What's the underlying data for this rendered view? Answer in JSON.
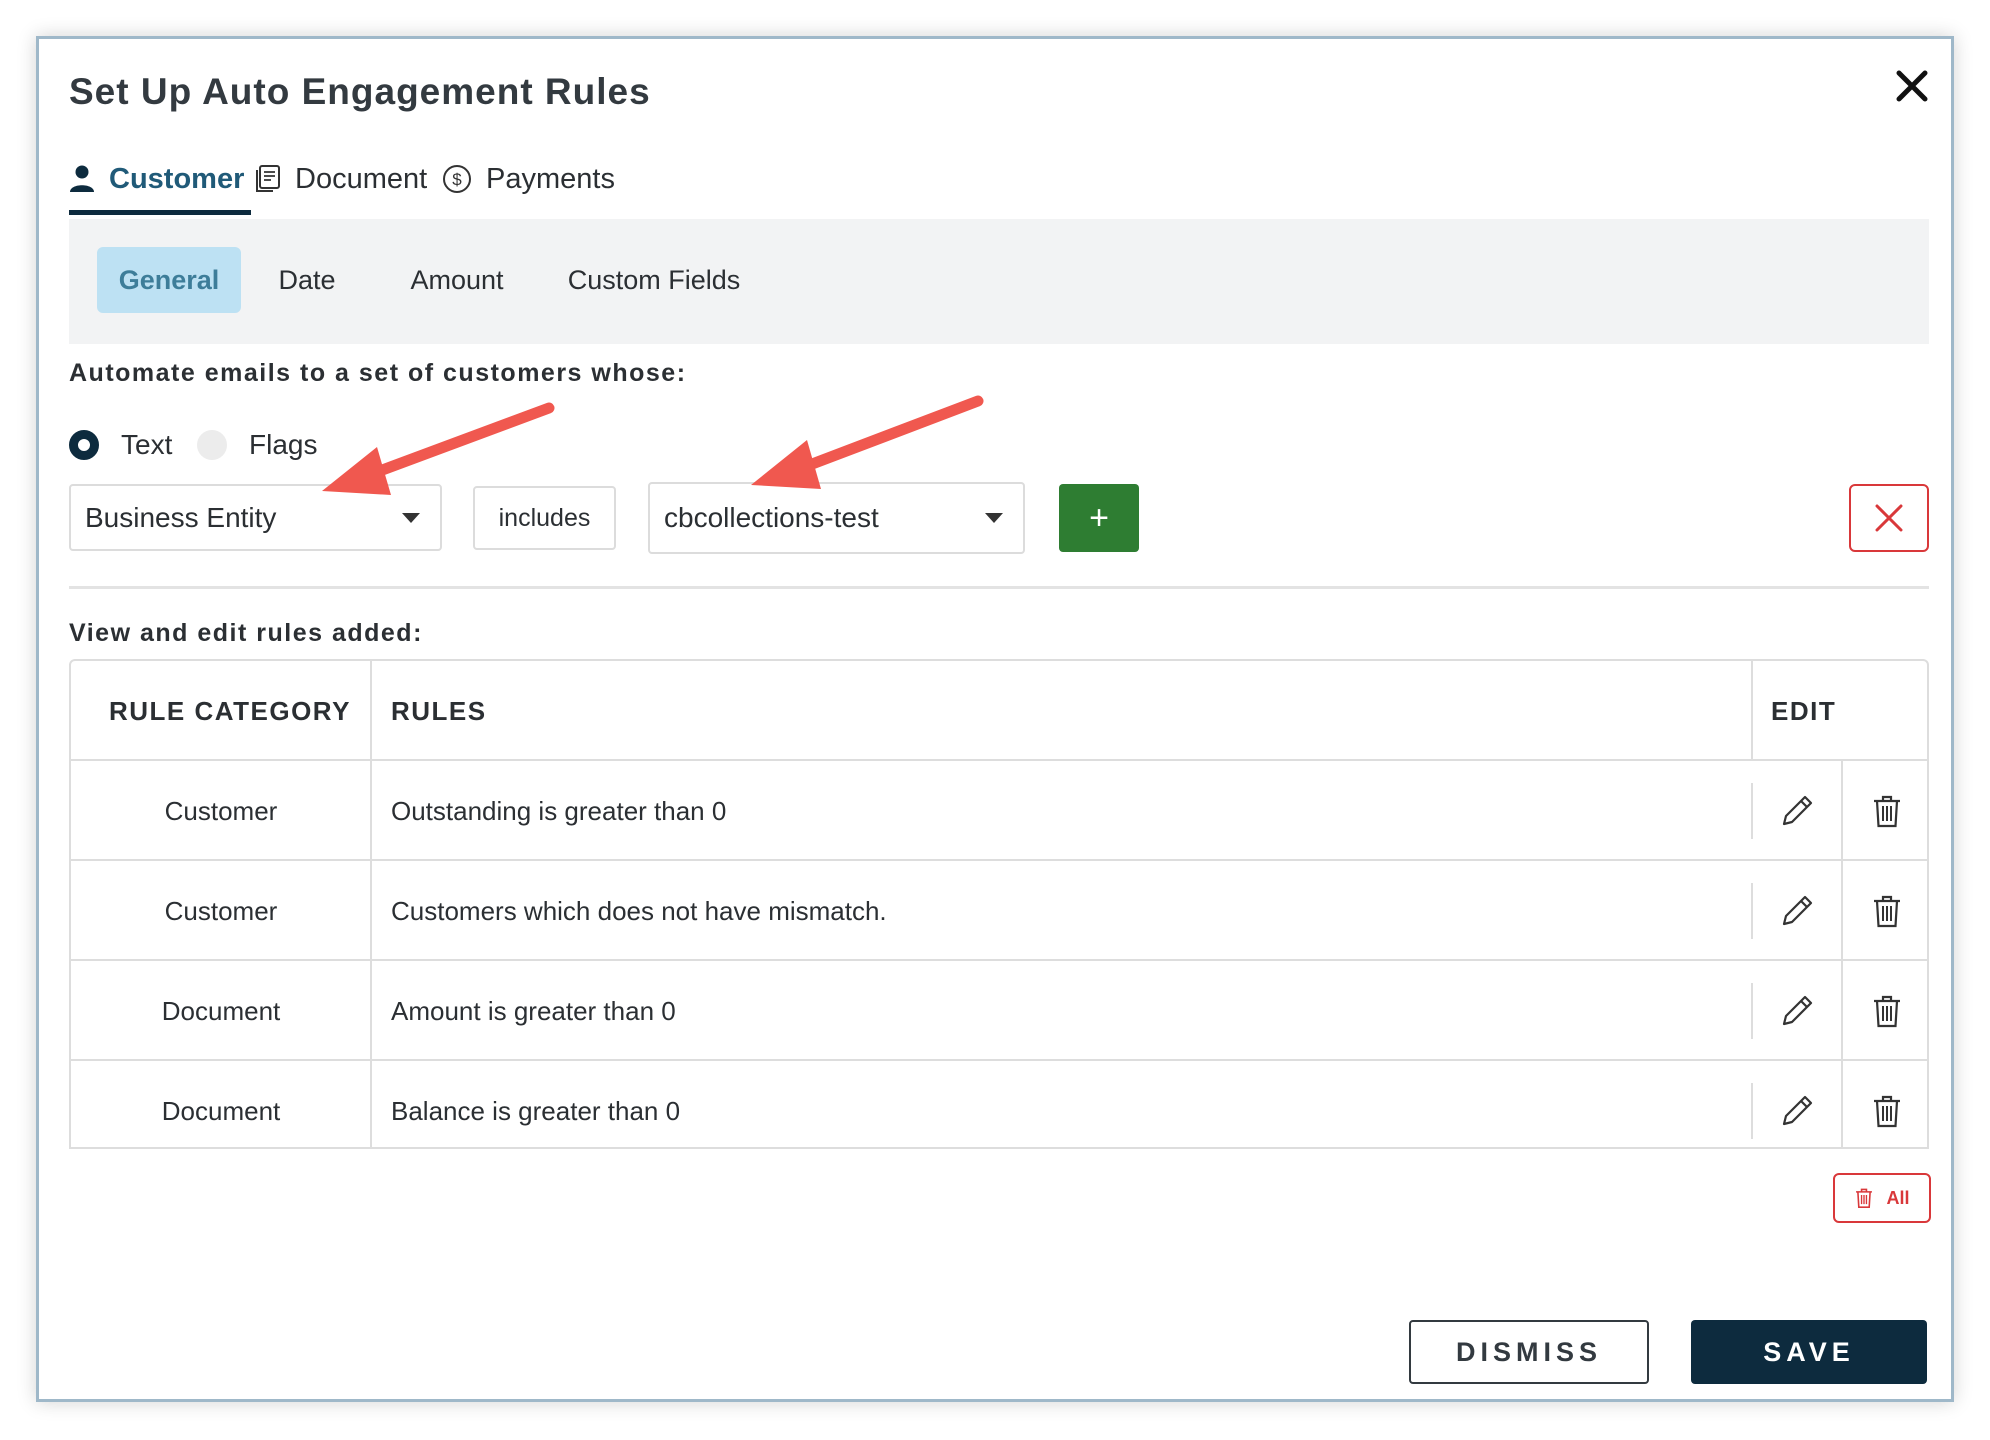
{
  "dialog": {
    "title": "Set Up Auto Engagement Rules"
  },
  "tabs": [
    {
      "label": "Customer",
      "icon": "person-icon",
      "active": true
    },
    {
      "label": "Document",
      "icon": "document-icon",
      "active": false
    },
    {
      "label": "Payments",
      "icon": "dollar-circle-icon",
      "active": false
    }
  ],
  "subtabs": [
    {
      "label": "General",
      "active": true
    },
    {
      "label": "Date",
      "active": false
    },
    {
      "label": "Amount",
      "active": false
    },
    {
      "label": "Custom Fields",
      "active": false
    }
  ],
  "automate": {
    "label": "Automate emails to a set of customers whose:",
    "radios": [
      {
        "label": "Text",
        "selected": true
      },
      {
        "label": "Flags",
        "selected": false
      }
    ]
  },
  "rule_builder": {
    "field_value": "Business Entity",
    "operator": "includes",
    "value": "cbcollections-test",
    "add_label": "+"
  },
  "rules_table": {
    "section_label": "View and edit rules added:",
    "headers": [
      "RULE CATEGORY",
      "RULES",
      "EDIT"
    ],
    "rows": [
      {
        "category": "Customer",
        "rule": "Outstanding is greater than 0"
      },
      {
        "category": "Customer",
        "rule": "Customers which does not have mismatch."
      },
      {
        "category": "Document",
        "rule": "Amount is greater than 0"
      },
      {
        "category": "Document",
        "rule": "Balance is greater than 0"
      }
    ]
  },
  "delete_all_label": "All",
  "footer": {
    "dismiss_label": "DISMISS",
    "save_label": "SAVE"
  },
  "colors": {
    "primary_dark": "#0d2b3e",
    "active_tab_text": "#205a78",
    "subtab_active_bg": "#bde1f3",
    "add_green": "#2e7d32",
    "danger_red": "#d9383a",
    "annotation_arrow": "#f0584f"
  }
}
